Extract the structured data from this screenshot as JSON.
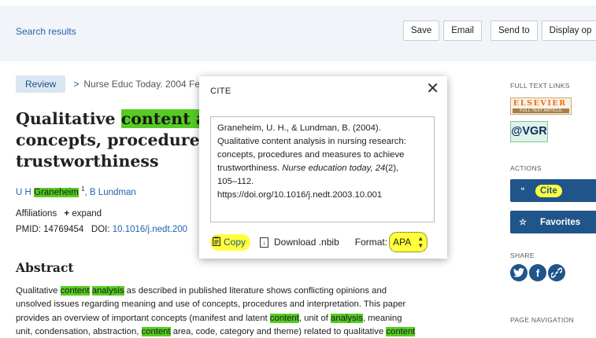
{
  "topbar": {
    "search_results": "Search results",
    "buttons": [
      "Save",
      "Email",
      "Send to",
      "Display op"
    ]
  },
  "article": {
    "badge": "Review",
    "journal_sep": ">",
    "journal": "Nurse Educ Today. 2004 Fe",
    "title_parts": [
      "Qualitative ",
      "content",
      " an",
      "concepts, procedures",
      "trustworthiness"
    ],
    "authors": {
      "a1_prefix": "U H ",
      "a1_hl": "Graneheim",
      "a1_sup": "1",
      "a2": ", B Lundman"
    },
    "affiliations": "Affiliations",
    "expand_plus": "+",
    "expand": "expand",
    "pmid": "PMID: 14769454",
    "doi_label": "DOI:",
    "doi": "10.1016/j.nedt.200",
    "abstract_heading": "Abstract",
    "abstract": {
      "l1a": "Qualitative ",
      "l1b": "content",
      "l1c": " ",
      "l1d": "analysis",
      "l1e": " as described in published literature shows conflicting opinions and",
      "l2": "unsolved issues regarding meaning and use of concepts, procedures and interpretation. This paper",
      "l3a": "provides an overview of important concepts (manifest and latent ",
      "l3b": "content",
      "l3c": ", unit of ",
      "l3d": "analysis",
      "l3e": ", meaning",
      "l4a": "unit, condensation, abstraction, ",
      "l4b": "content",
      "l4c": " area, code, category and theme) related to qualitative ",
      "l4d": "content"
    }
  },
  "sidebar": {
    "full_text_links": "FULL TEXT LINKS",
    "elsevier": "ELSEVIER",
    "elsevier_sub": "FULL-TEXT ARTICLE",
    "vgr": "@VGR",
    "actions": "ACTIONS",
    "cite": "Cite",
    "cite_icon": "“",
    "favorites": "Favorites",
    "fav_icon": "☆",
    "share": "SHARE",
    "page_navigation": "PAGE NAVIGATION"
  },
  "modal": {
    "title": "CITE",
    "close": "✕",
    "citation": {
      "line1": "Graneheim, U. H., & Lundman, B. (2004).",
      "line2": "Qualitative content analysis in nursing research:",
      "line3": "concepts, procedures and measures to achieve",
      "line4a": "trustworthiness. ",
      "line4b": "Nurse education today, 24",
      "line4c": "(2),",
      "line5": "105–112.",
      "line6": "https://doi.org/10.1016/j.nedt.2003.10.001"
    },
    "copy": "Copy",
    "download": "Download .nbib",
    "format_label": "Format:",
    "format_value": "APA"
  },
  "colors": {
    "accent": "#20558a",
    "highlight_green": "#56cc23",
    "annotation_yellow": "#ffff3c"
  }
}
